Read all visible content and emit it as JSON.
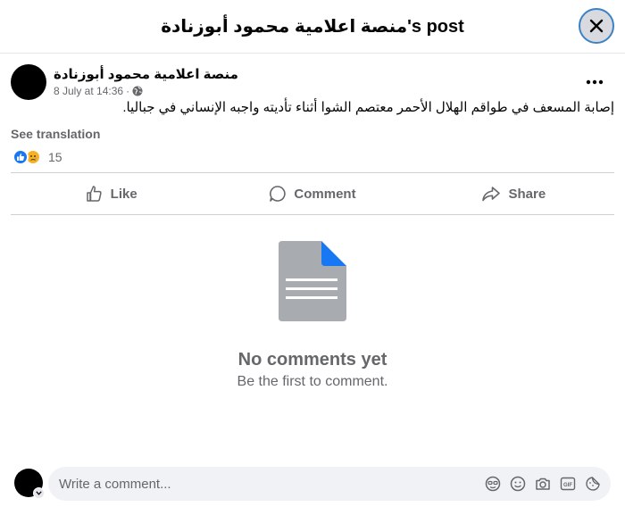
{
  "header": {
    "title": "منصة اعلامية محمود أبوزنادة's post"
  },
  "post": {
    "author": "منصة اعلامية محمود أبوزنادة",
    "timestamp": "8 July at 14:36",
    "meta_separator": "·",
    "audience_icon": "globe-icon",
    "text": "إصابة المسعف في طواقم الهلال الأحمر معتصم الشوا أثناء تأديته واجبه الإنساني في جباليا.",
    "see_translation": "See translation",
    "reactions": {
      "icons": [
        "like-icon",
        "sad-icon"
      ],
      "count": "15"
    }
  },
  "actions": {
    "like": "Like",
    "comment": "Comment",
    "share": "Share"
  },
  "empty_state": {
    "title": "No comments yet",
    "subtitle": "Be the first to comment."
  },
  "composer": {
    "placeholder": "Write a comment...",
    "tools": [
      "avatar-sticker-icon",
      "emoji-icon",
      "camera-icon",
      "gif-icon",
      "sticker-icon"
    ]
  },
  "colors": {
    "accent": "#1877f2",
    "secondary_text": "#65676b",
    "divider": "#ced0d4",
    "doc_gray": "#a8abaf"
  }
}
